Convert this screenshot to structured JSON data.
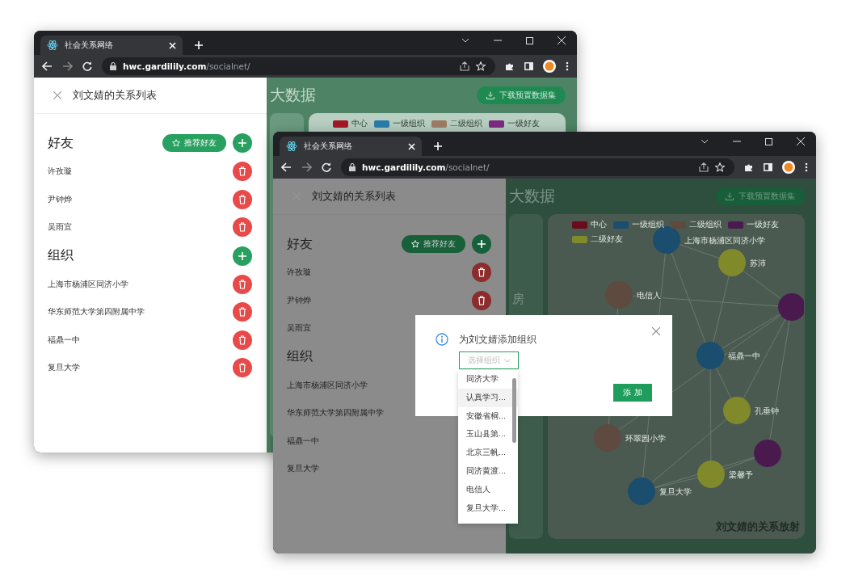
{
  "windows": [
    {
      "kind": "back",
      "tab_title": "社会关系网络",
      "url_host": "hwc.gardilily.com",
      "url_path": "/socialnet/",
      "panel": {
        "title": "刘文婧的关系列表",
        "sections": [
          {
            "heading": "好友",
            "recommend_button": "推荐好友",
            "items": [
              "许孜璇",
              "尹钟烨",
              "吴雨宜"
            ]
          },
          {
            "heading": "组织",
            "items": [
              "上海市杨浦区同济小学",
              "华东师范大学第四附属中学",
              "福鼎一中",
              "复旦大学"
            ]
          }
        ]
      },
      "main": {
        "heading": "大数据",
        "download_button": "下载预置数据集",
        "legend": [
          {
            "label": "中心",
            "color": "#a01828"
          },
          {
            "label": "一级组织",
            "color": "#2a7aa8"
          },
          {
            "label": "二级组织",
            "color": "#9a7a62"
          },
          {
            "label": "一级好友",
            "color": "#7a2a7e"
          }
        ]
      }
    },
    {
      "kind": "front",
      "tab_title": "社会关系网络",
      "url_host": "hwc.gardilily.com",
      "url_path": "/socialnet/",
      "panel": {
        "title": "刘文婧的关系列表",
        "sections": [
          {
            "heading": "好友",
            "recommend_button": "推荐好友",
            "items": [
              "许孜璇",
              "尹钟烨",
              "吴雨宜"
            ]
          },
          {
            "heading": "组织",
            "items": [
              "上海市杨浦区同济小学",
              "华东师范大学第四附属中学",
              "福鼎一中",
              "复旦大学"
            ]
          }
        ]
      },
      "main": {
        "heading": "大数据",
        "download_button": "下载预置数据集",
        "side_text": "房",
        "legend": [
          {
            "label": "中心",
            "color": "#6a0a1a"
          },
          {
            "label": "一级组织",
            "color": "#1a4d6e"
          },
          {
            "label": "二级组织",
            "color": "#5e4a3e"
          },
          {
            "label": "一级好友",
            "color": "#4a1a4e"
          },
          {
            "label": "二级好友",
            "color": "#808a2a"
          }
        ],
        "graph": {
          "caption": "刘文婧的关系放射",
          "nodes": [
            {
              "label": "上海市杨浦区同济小学",
              "color": "#1a4d6e"
            },
            {
              "label": "苏沛",
              "color": "#808a2a"
            },
            {
              "color": "#4a1a4e"
            },
            {
              "label": "电信人",
              "color": "#5e4a3e"
            },
            {
              "label": "福鼎一中",
              "color": "#1a4d6e"
            },
            {
              "label": "孔垂钟",
              "color": "#808a2a"
            },
            {
              "label": "环翠园小学",
              "color": "#5e4a3e"
            },
            {
              "color": "#4a1a4e"
            },
            {
              "label": "梁馨予",
              "color": "#808a2a"
            },
            {
              "label": "复旦大学",
              "color": "#1a4d6e"
            }
          ]
        }
      }
    }
  ],
  "dialog": {
    "title": "为刘文婧添加组织",
    "select_placeholder": "选择组织",
    "add_button": "添 加",
    "options": [
      {
        "label": "同济大学",
        "hovered": false
      },
      {
        "label": "认真学习...",
        "hovered": true
      },
      {
        "label": "安徽省桐...",
        "hovered": false
      },
      {
        "label": "玉山县第...",
        "hovered": false
      },
      {
        "label": "北京三帆...",
        "hovered": false
      },
      {
        "label": "同济黄渡...",
        "hovered": false
      },
      {
        "label": "电信人",
        "hovered": false
      },
      {
        "label": "复旦大学...",
        "hovered": false
      }
    ]
  }
}
